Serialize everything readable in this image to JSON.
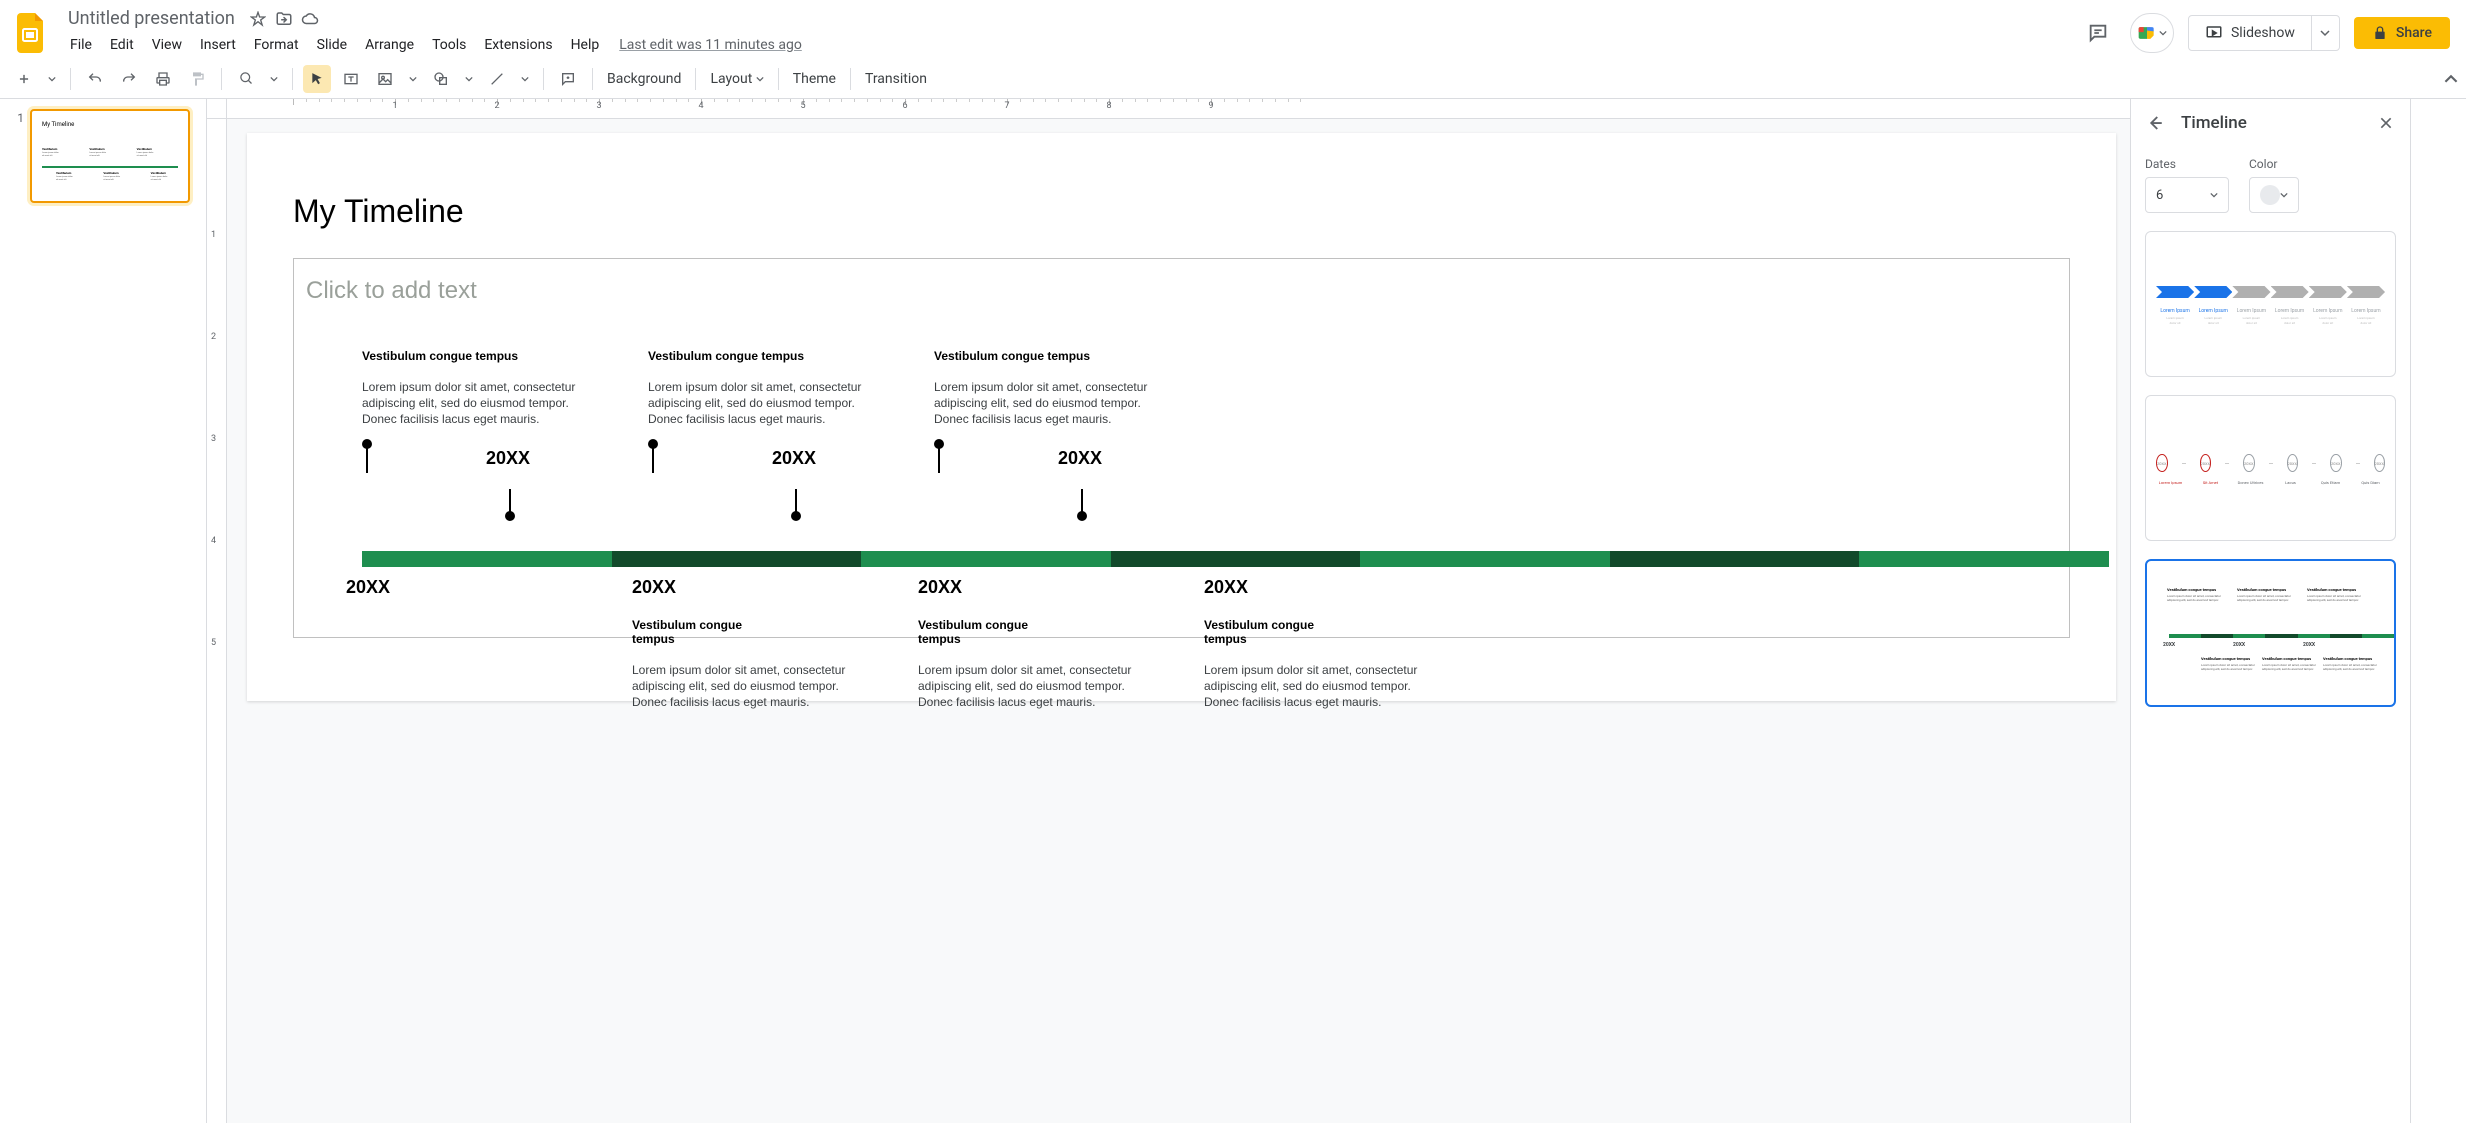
{
  "header": {
    "doc_title": "Untitled presentation",
    "last_edit": "Last edit was 11 minutes ago",
    "menu": [
      "File",
      "Edit",
      "View",
      "Insert",
      "Format",
      "Slide",
      "Arrange",
      "Tools",
      "Extensions",
      "Help"
    ],
    "slideshow": "Slideshow",
    "share": "Share"
  },
  "toolbar": {
    "background": "Background",
    "layout": "Layout",
    "theme": "Theme",
    "transition": "Transition"
  },
  "filmstrip": {
    "slide_number": "1",
    "thumb_title": "My Timeline"
  },
  "ruler_h": [
    "1",
    "2",
    "3",
    "4",
    "5",
    "6",
    "7",
    "8",
    "9"
  ],
  "ruler_v": [
    "1",
    "2",
    "3",
    "4",
    "5"
  ],
  "slide": {
    "title": "My Timeline",
    "placeholder": "Click to add text",
    "item_heading": "Vestibulum congue tempus",
    "item_body": "Lorem ipsum dolor sit amet, consectetur adipiscing elit, sed do eiusmod tempor. Donec facilisis lacus eget mauris.",
    "year": "20XX"
  },
  "panel": {
    "title": "Timeline",
    "dates_label": "Dates",
    "dates_value": "6",
    "color_label": "Color",
    "tpl1_labels": [
      "Lorem Ipsum",
      "Lorem Ipsum",
      "Lorem Ipsum",
      "Lorem Ipsum",
      "Lorem Ipsum",
      "Lorem Ipsum"
    ],
    "tpl2_circ": "20XX",
    "tpl2_labels": [
      "Lorem Ipsum",
      "Sit Amet",
      "Donec Ultrices",
      "Lacus",
      "Quis Etiam",
      "Quis Diam"
    ],
    "tpl3_heading": "Vestibulum congue tempus",
    "tpl3_body": "Lorem ipsum dolor sit amet, consectetur adipiscing elit, sed do eiusmod tempor.",
    "tpl3_year": "20XX"
  }
}
